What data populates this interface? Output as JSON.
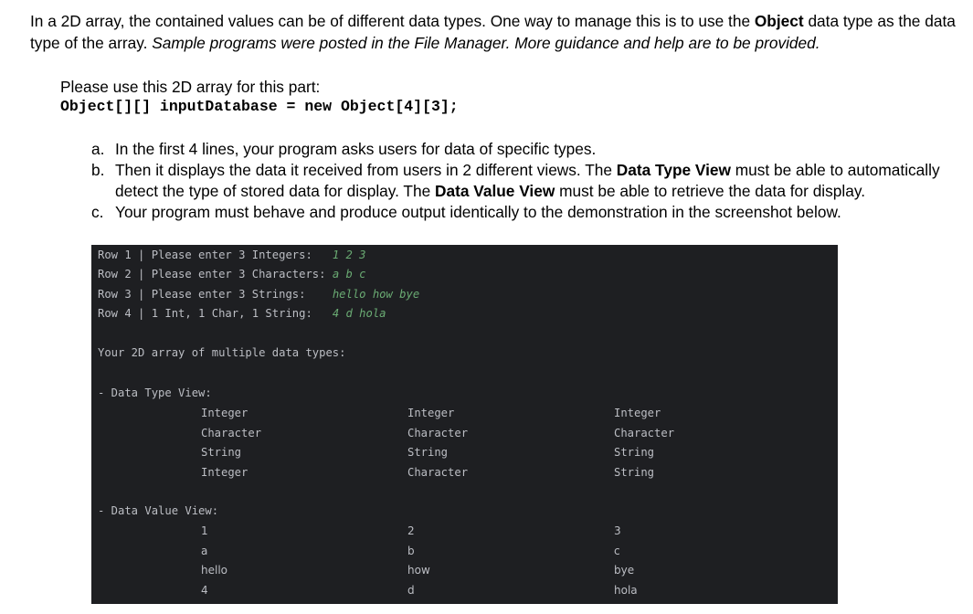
{
  "paragraph": {
    "s1": "In a 2D array, the contained values can be of different data types. One way to manage this is to use the ",
    "s1_bold": "Object",
    "s1_end": " data type as the data type of the array. ",
    "s2_italic": "Sample programs were posted in the File Manager. More guidance and help are to be provided."
  },
  "intro": "Please use this 2D array for this part:",
  "code": "Object[][] inputDatabase = new Object[4][3];",
  "list": [
    {
      "marker": "a.",
      "text": "In the first 4 lines, your program asks users for data of specific types."
    },
    {
      "marker": "b.",
      "t1": "Then it displays the data it received from users in 2 different views. The ",
      "b1": "Data Type View",
      "t2": " must be able to automatically detect the type of stored data for display. The ",
      "b2": "Data Value View",
      "t3": " must be able to retrieve the data for display."
    },
    {
      "marker": "c.",
      "text": "Your program must behave and produce output identically to the demonstration in the screenshot below."
    }
  ],
  "terminal": {
    "prompts": [
      {
        "label": "Row 1 | Please enter 3 Integers:   ",
        "input": "1 2 3"
      },
      {
        "label": "Row 2 | Please enter 3 Characters: ",
        "input": "a b c"
      },
      {
        "label": "Row 3 | Please enter 3 Strings:    ",
        "input": "hello how bye"
      },
      {
        "label": "Row 4 | 1 Int, 1 Char, 1 String:   ",
        "input": "4 d hola"
      }
    ],
    "summary": "Your 2D array of multiple data types:",
    "type_view_label": "- Data Type View:",
    "type_view": [
      [
        "Integer",
        "Integer",
        "Integer"
      ],
      [
        "Character",
        "Character",
        "Character"
      ],
      [
        "String",
        "String",
        "String"
      ],
      [
        "Integer",
        "Character",
        "String"
      ]
    ],
    "value_view_label": "- Data Value View:",
    "value_view": [
      [
        "1",
        "2",
        "3"
      ],
      [
        "a",
        "b",
        "c"
      ],
      [
        "hello",
        "how",
        "bye"
      ],
      [
        "4",
        "d",
        "hola"
      ]
    ]
  }
}
